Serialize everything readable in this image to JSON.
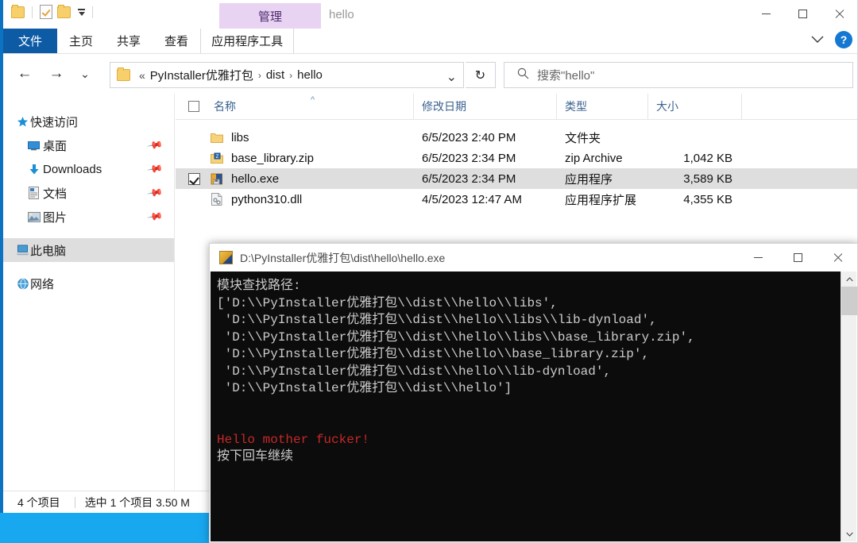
{
  "window": {
    "context_tab": "管理",
    "title": "hello",
    "caption": {
      "minimize": "—",
      "maximize": "▫",
      "close": "✕"
    }
  },
  "quick_access_toolbar": {
    "icons": [
      "folder-icon",
      "properties-icon",
      "new-folder-icon",
      "customize-dropdown-icon"
    ]
  },
  "ribbon": {
    "tabs": [
      {
        "label": "文件",
        "name": "tab-file"
      },
      {
        "label": "主页",
        "name": "tab-home"
      },
      {
        "label": "共享",
        "name": "tab-share"
      },
      {
        "label": "查看",
        "name": "tab-view"
      },
      {
        "label": "应用程序工具",
        "name": "tab-application-tools"
      }
    ],
    "collapse_icon": "chevron-down-icon",
    "help_label": "?"
  },
  "addressbar": {
    "back": "←",
    "forward": "→",
    "recent": "⌄",
    "up": "↑",
    "prefix": "«",
    "breadcrumbs": [
      "PyInstaller优雅打包",
      "dist",
      "hello"
    ],
    "separator": "›",
    "dropdown": "⌄",
    "refresh": "↻"
  },
  "search": {
    "icon": "search-icon",
    "placeholder": "搜索\"hello\""
  },
  "navigation_pane": {
    "items": [
      {
        "label": "快速访问",
        "icon": "star-icon",
        "indent": false,
        "pinned": false,
        "selected": false
      },
      {
        "label": "桌面",
        "icon": "desktop-icon",
        "indent": true,
        "pinned": true,
        "selected": false
      },
      {
        "label": "Downloads",
        "icon": "download-icon",
        "indent": true,
        "pinned": true,
        "selected": false
      },
      {
        "label": "文档",
        "icon": "document-icon",
        "indent": true,
        "pinned": true,
        "selected": false
      },
      {
        "label": "图片",
        "icon": "picture-icon",
        "indent": true,
        "pinned": true,
        "selected": false
      },
      {
        "label": "此电脑",
        "icon": "this-pc-icon",
        "indent": false,
        "pinned": false,
        "selected": true
      },
      {
        "label": "网络",
        "icon": "network-icon",
        "indent": false,
        "pinned": false,
        "selected": false
      }
    ],
    "pin_glyph": "📌"
  },
  "filelist": {
    "columns": [
      {
        "label": "名称",
        "name": "column-name",
        "sorted": true,
        "sort_glyph": "^"
      },
      {
        "label": "修改日期",
        "name": "column-date-modified"
      },
      {
        "label": "类型",
        "name": "column-type"
      },
      {
        "label": "大小",
        "name": "column-size"
      }
    ],
    "rows": [
      {
        "name": "libs",
        "date": "6/5/2023 2:40 PM",
        "type": "文件夹",
        "size": "",
        "icon": "folder-icon",
        "checked": false,
        "selected": false
      },
      {
        "name": "base_library.zip",
        "date": "6/5/2023 2:34 PM",
        "type": "zip Archive",
        "size": "1,042 KB",
        "icon": "zip-icon",
        "checked": false,
        "selected": false
      },
      {
        "name": "hello.exe",
        "date": "6/5/2023 2:34 PM",
        "type": "应用程序",
        "size": "3,589 KB",
        "icon": "exe-icon",
        "checked": true,
        "selected": true
      },
      {
        "name": "python310.dll",
        "date": "4/5/2023 12:47 AM",
        "type": "应用程序扩展",
        "size": "4,355 KB",
        "icon": "dll-icon",
        "checked": false,
        "selected": false
      }
    ]
  },
  "statusbar": {
    "item_count": "4 个项目",
    "selection": "选中 1 个项目 3.50 M"
  },
  "console": {
    "title": "D:\\PyInstaller优雅打包\\dist\\hello\\hello.exe",
    "icon": "console-app-icon",
    "caption": {
      "minimize": "—",
      "maximize": "▫",
      "close": "✕"
    },
    "lines": [
      {
        "text": "模块查找路径:",
        "color": "grey"
      },
      {
        "text": "['D:\\\\PyInstaller优雅打包\\\\dist\\\\hello\\\\libs',",
        "color": "grey"
      },
      {
        "text": " 'D:\\\\PyInstaller优雅打包\\\\dist\\\\hello\\\\libs\\\\lib-dynload',",
        "color": "grey"
      },
      {
        "text": " 'D:\\\\PyInstaller优雅打包\\\\dist\\\\hello\\\\libs\\\\base_library.zip',",
        "color": "grey"
      },
      {
        "text": " 'D:\\\\PyInstaller优雅打包\\\\dist\\\\hello\\\\base_library.zip',",
        "color": "grey"
      },
      {
        "text": " 'D:\\\\PyInstaller优雅打包\\\\dist\\\\hello\\\\lib-dynload',",
        "color": "grey"
      },
      {
        "text": " 'D:\\\\PyInstaller优雅打包\\\\dist\\\\hello']",
        "color": "grey"
      },
      {
        "text": "",
        "color": "grey"
      },
      {
        "text": "",
        "color": "grey"
      },
      {
        "text": "Hello mother fucker!",
        "color": "red"
      },
      {
        "text": "按下回车继续",
        "color": "grey"
      }
    ],
    "scrollbar": {
      "up": "^",
      "down": "v"
    }
  },
  "colors": {
    "accent_blue": "#0d5ba5",
    "context_tab_purple": "#e9d3f3",
    "desktop_blue": "#18a6ee",
    "console_bg": "#0c0c0c",
    "console_text": "#cccccc",
    "console_red": "#c62828",
    "selection_grey": "#dededf"
  }
}
